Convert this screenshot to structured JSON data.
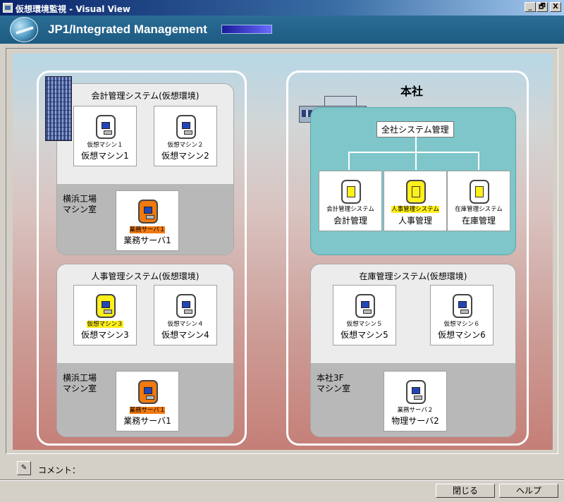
{
  "window": {
    "title": "仮想環境監視 - Visual View",
    "minimize_label": "_",
    "restore_label": "🗗",
    "close_label": "X"
  },
  "header": {
    "product_name": "JP1/Integrated Management",
    "logo_icon": "jp1-logo-icon"
  },
  "colors": {
    "header_bg": "#1d5b82",
    "highlight_yellow": "#ffef1a",
    "status_orange": "#f07a10",
    "teal_group": "#7ec6ca"
  },
  "left_top_group": {
    "title": "会計管理システム(仮想環境)",
    "location": "横浜工場\nマシン室",
    "nodes": [
      {
        "sub": "仮想マシン１",
        "name": "仮想マシン1",
        "icon": "pc-icon"
      },
      {
        "sub": "仮想マシン２",
        "name": "仮想マシン2",
        "icon": "pc-icon"
      },
      {
        "sub": "業務サーバ１",
        "name": "業務サーバ1",
        "icon": "pc-icon",
        "status": "orange"
      }
    ]
  },
  "left_bottom_group": {
    "title": "人事管理システム(仮想環境)",
    "location": "横浜工場\nマシン室",
    "nodes": [
      {
        "sub": "仮想マシン３",
        "name": "仮想マシン3",
        "icon": "pc-icon",
        "status": "yellow"
      },
      {
        "sub": "仮想マシン４",
        "name": "仮想マシン4",
        "icon": "pc-icon"
      },
      {
        "sub": "業務サーバ１",
        "name": "業務サーバ1",
        "icon": "pc-icon",
        "status": "orange"
      }
    ]
  },
  "right_top_group": {
    "title": "本社",
    "root_label": "全社システム管理",
    "nodes": [
      {
        "sub": "会計管理システム",
        "name": "会計管理",
        "icon": "document-icon"
      },
      {
        "sub": "人事管理システム",
        "name": "人事管理",
        "icon": "document-icon",
        "status": "yellow"
      },
      {
        "sub": "在庫管理システム",
        "name": "在庫管理",
        "icon": "document-icon"
      }
    ]
  },
  "right_bottom_group": {
    "title": "在庫管理システム(仮想環境)",
    "location": "本社3F\nマシン室",
    "nodes": [
      {
        "sub": "仮想マシン５",
        "name": "仮想マシン5",
        "icon": "pc-icon"
      },
      {
        "sub": "仮想マシン６",
        "name": "仮想マシン6",
        "icon": "pc-icon"
      },
      {
        "sub": "業務サーバ２",
        "name": "物理サーバ2",
        "icon": "pc-icon"
      }
    ]
  },
  "footer": {
    "comment_label": "コメント：",
    "close_button": "閉じる",
    "help_button": "ヘルプ"
  }
}
